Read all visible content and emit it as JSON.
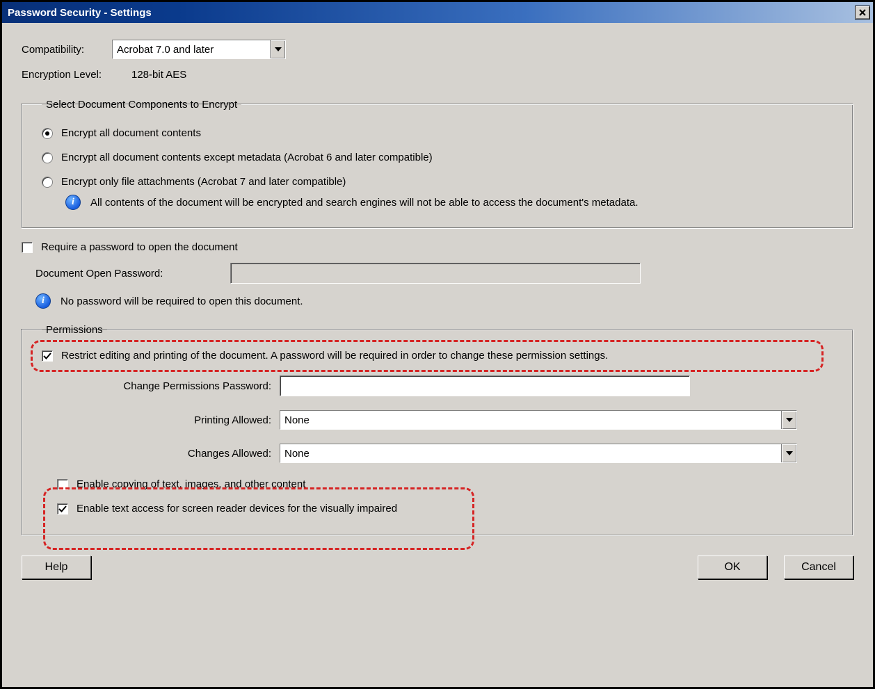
{
  "title": "Password Security - Settings",
  "compat": {
    "label": "Compatibility:",
    "value": "Acrobat 7.0 and later"
  },
  "encryption_level": {
    "label": "Encryption  Level:",
    "value": "128-bit AES"
  },
  "group_encrypt": {
    "legend": "Select Document Components to Encrypt",
    "options": {
      "opt1": "Encrypt all document contents",
      "opt2": "Encrypt all document contents except metadata (Acrobat 6 and later compatible)",
      "opt3": "Encrypt only file attachments (Acrobat 7 and later compatible)"
    },
    "info": "All contents of the document will be encrypted and search engines will not be able to access the document's metadata."
  },
  "open_password": {
    "require_label": "Require a password to open the document",
    "field_label": "Document Open Password:",
    "info": "No password will be required to open this document."
  },
  "permissions": {
    "legend": "Permissions",
    "restrict_label": "Restrict editing and printing of the document. A password will be required in order to change these permission settings.",
    "change_pw_label": "Change Permissions Password:",
    "printing_label": "Printing Allowed:",
    "printing_value": "None",
    "changes_label": "Changes Allowed:",
    "changes_value": "None",
    "enable_copy_label": "Enable copying of text, images, and other content",
    "enable_screenreader_label": "Enable text access for screen reader devices for the visually impaired"
  },
  "buttons": {
    "help": "Help",
    "ok": "OK",
    "cancel": "Cancel"
  }
}
